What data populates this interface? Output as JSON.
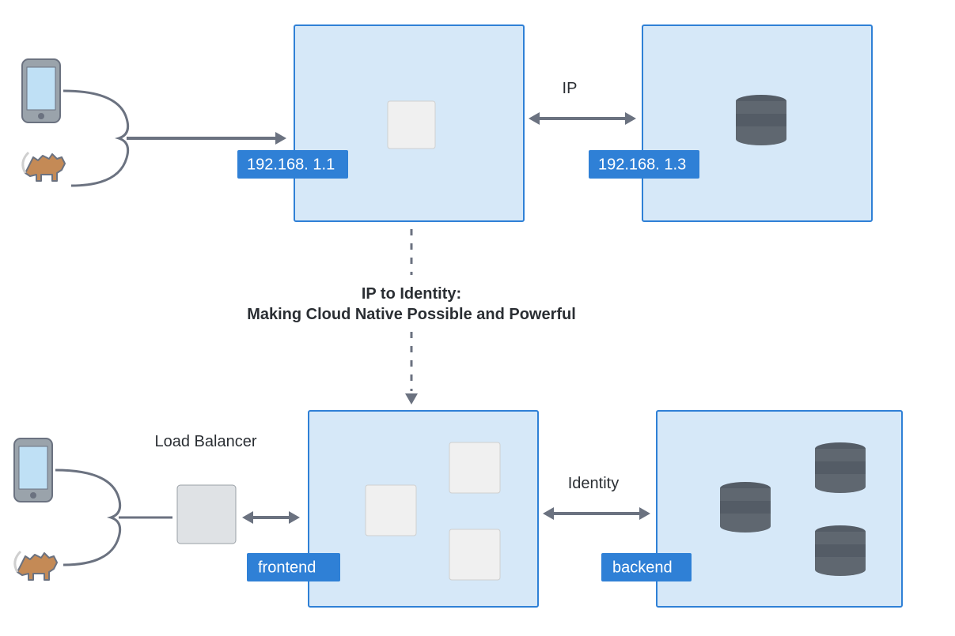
{
  "top": {
    "left_label": "192.168. 1.1",
    "right_label": "192.168. 1.3",
    "link_label": "IP"
  },
  "center_title_line1": "IP to Identity:",
  "center_title_line2": "Making Cloud Native Possible and Powerful",
  "bottom": {
    "lb_label": "Load Balancer",
    "left_label": "frontend",
    "right_label": "backend",
    "link_label": "Identity"
  }
}
